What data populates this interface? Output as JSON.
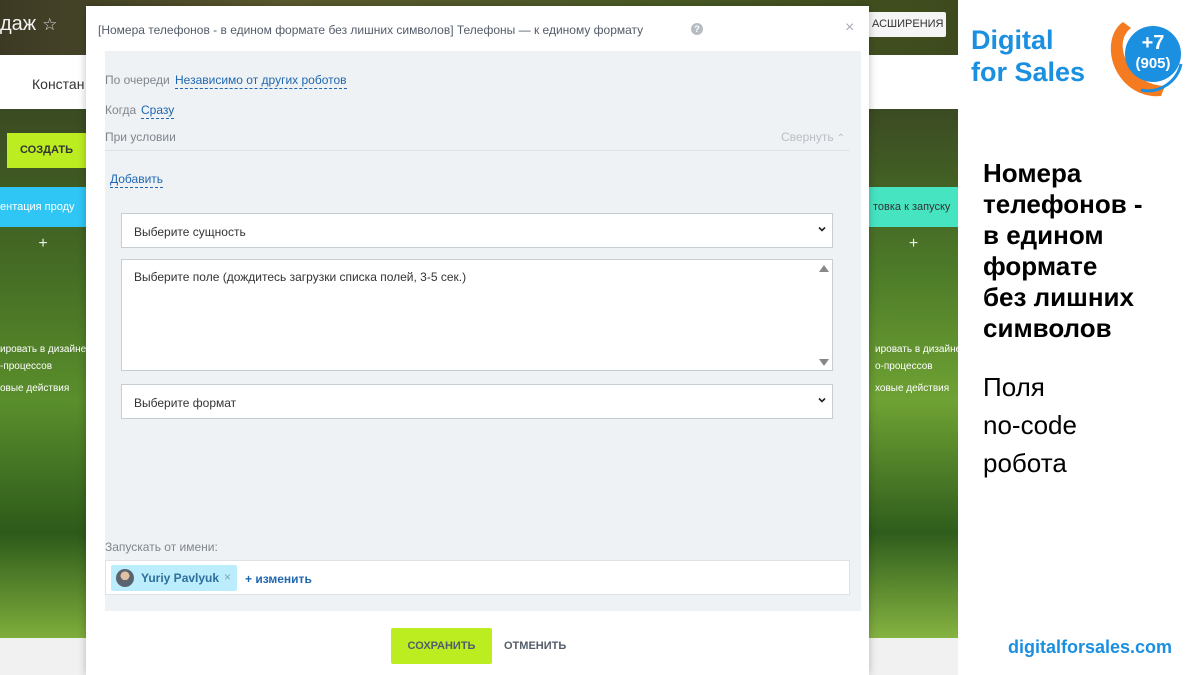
{
  "background_app": {
    "title": "даж",
    "star": "☆",
    "extensions_button": "АСШИРЕНИЯ",
    "nav_tab": "Констан",
    "create_button": "СОЗДАТЬ",
    "stage_left": "ентация проду",
    "stage_right": "товка к запуску",
    "plus": "+",
    "left_hint_lines": [
      "ировать в дизайне",
      "-процессов"
    ],
    "left_hint_2": "овые действия",
    "right_hint_lines": [
      "ировать в дизайнере",
      "о-процессов"
    ],
    "right_hint_2": "ховые действия"
  },
  "modal": {
    "title": "[Номера телефонов - в едином формате без лишних символов] Телефоны — к единому формату",
    "help_icon": "?",
    "close_icon": "×",
    "queue_label": "По очереди",
    "queue_value": "Независимо от других роботов",
    "when_label": "Когда",
    "when_value": "Сразу",
    "condition_label": "При условии",
    "collapse_label": "Свернуть",
    "add_link": "Добавить",
    "entity_select": {
      "placeholder": "Выберите сущность"
    },
    "field_list": {
      "placeholder": "Выберите поле (дождитесь загрузки списка полей, 3-5 сек.)"
    },
    "format_select": {
      "placeholder": "Выберите формат"
    },
    "run_as_label": "Запускать от имени:",
    "user": {
      "name": "Yuriy Pavlyuk",
      "remove": "×"
    },
    "change_link": "+ изменить",
    "save_button": "СОХРАНИТЬ",
    "cancel_button": "ОТМЕНИТЬ"
  },
  "promo": {
    "brand_line1": "Digital",
    "brand_line2": "for Sales",
    "badge_line1": "+7",
    "badge_line2": "(905)",
    "heading_lines": [
      "Номера",
      "телефонов -",
      "в едином",
      "формате",
      "без лишних",
      "символов"
    ],
    "sub_lines": [
      "Поля",
      "no-code",
      "робота"
    ],
    "url": "digitalforsales.com"
  },
  "colors": {
    "accent_green": "#bbed21",
    "link_blue": "#2067b0",
    "brand_blue": "#1b8fe0",
    "brand_orange": "#f47b20",
    "stage_blue": "#2fc6f6",
    "stage_teal": "#47e4c2"
  }
}
